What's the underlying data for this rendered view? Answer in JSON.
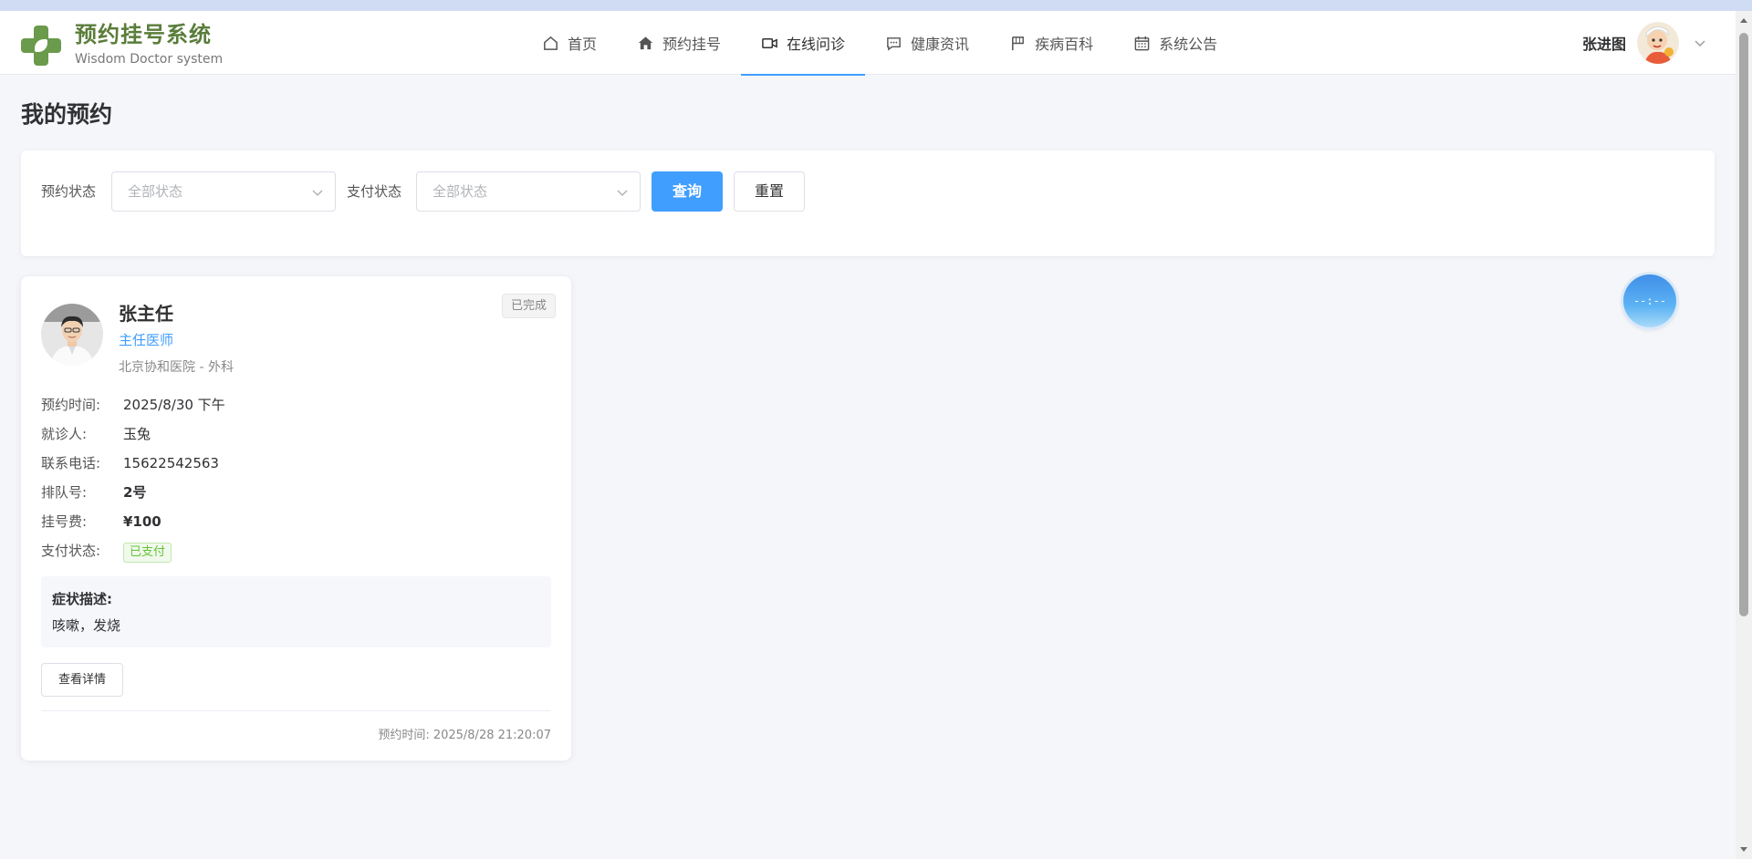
{
  "brand": {
    "title": "预约挂号系统",
    "subtitle": "Wisdom Doctor system",
    "color": "#6a9a4b"
  },
  "nav": {
    "items": [
      {
        "label": "首页",
        "icon": "home-outline-icon"
      },
      {
        "label": "预约挂号",
        "icon": "home-filled-icon"
      },
      {
        "label": "在线问诊",
        "icon": "video-camera-icon",
        "active": true
      },
      {
        "label": "健康资讯",
        "icon": "chat-icon"
      },
      {
        "label": "疾病百科",
        "icon": "flag-icon"
      },
      {
        "label": "系统公告",
        "icon": "calendar-icon"
      }
    ],
    "accent": "#409eff"
  },
  "user": {
    "name": "张进图",
    "avatar_icon": "user-avatar",
    "menu_icon": "chevron-down-icon"
  },
  "page": {
    "title": "我的预约"
  },
  "filter": {
    "appointment_status_label": "预约状态",
    "appointment_status_placeholder": "全部状态",
    "payment_status_label": "支付状态",
    "payment_status_placeholder": "全部状态",
    "query_label": "查询",
    "reset_label": "重置"
  },
  "appointment": {
    "doctor_name": "张主任",
    "doctor_title": "主任医师",
    "hospital": "北京协和医院 - 外科",
    "status": "已完成",
    "fields": {
      "time_label": "预约时间:",
      "time_value": "2025/8/30 下午",
      "patient_label": "就诊人:",
      "patient_value": "玉兔",
      "phone_label": "联系电话:",
      "phone_value": "15622542563",
      "queue_label": "排队号:",
      "queue_value": "2号",
      "fee_label": "挂号费:",
      "fee_value": "¥100",
      "pay_label": "支付状态:",
      "pay_value": "已支付"
    },
    "symptom_label": "症状描述:",
    "symptom_value": "咳嗽，发烧",
    "detail_button": "查看详情",
    "booked_at": "预约时间: 2025/8/28 21:20:07"
  },
  "float_widget": {
    "text": "--:--"
  }
}
